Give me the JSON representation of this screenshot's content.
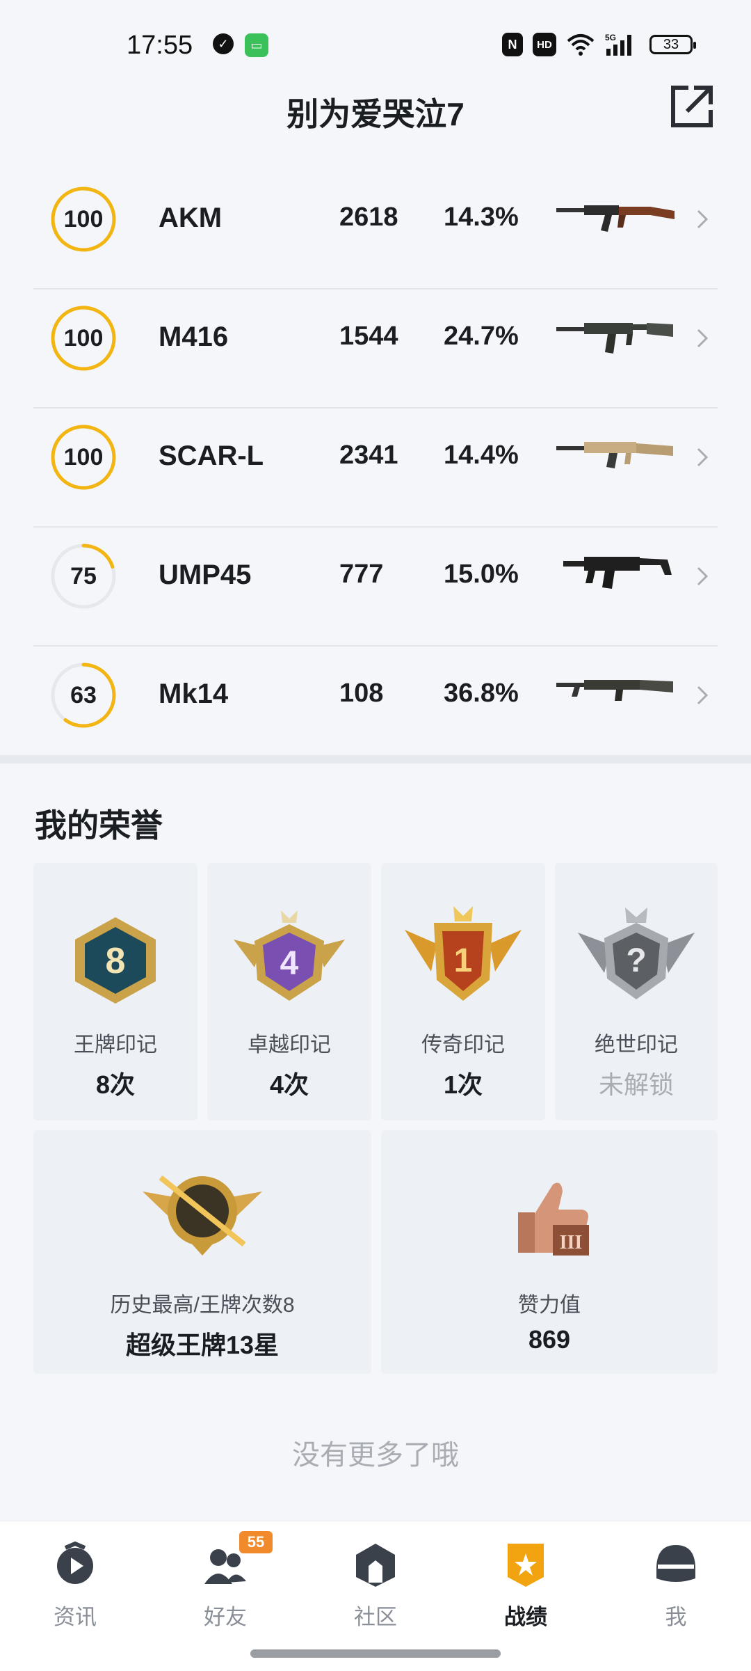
{
  "status_bar": {
    "time": "17:55",
    "battery": "33",
    "icons": [
      "shield-icon",
      "message-icon",
      "nfc-icon",
      "hd-icon",
      "wifi-icon",
      "signal-5g-icon",
      "battery-icon"
    ]
  },
  "header": {
    "title": "别为爱哭泣7",
    "share_icon": "share-external-icon"
  },
  "weapons": [
    {
      "level": "100",
      "progress": 1.0,
      "name": "AKM",
      "kills": "2618",
      "rate": "14.3%"
    },
    {
      "level": "100",
      "progress": 1.0,
      "name": "M416",
      "kills": "1544",
      "rate": "24.7%"
    },
    {
      "level": "100",
      "progress": 1.0,
      "name": "SCAR-L",
      "kills": "2341",
      "rate": "14.4%"
    },
    {
      "level": "75",
      "progress": 0.2,
      "name": "UMP45",
      "kills": "777",
      "rate": "15.0%"
    },
    {
      "level": "63",
      "progress": 0.6,
      "name": "Mk14",
      "kills": "108",
      "rate": "36.8%"
    }
  ],
  "honor": {
    "title": "我的荣誉",
    "marks": [
      {
        "label": "王牌印记",
        "value": "8次",
        "badge_number": "8"
      },
      {
        "label": "卓越印记",
        "value": "4次",
        "badge_number": "4"
      },
      {
        "label": "传奇印记",
        "value": "1次",
        "badge_number": "1"
      },
      {
        "label": "绝世印记",
        "value": "未解锁",
        "badge_number": "?"
      }
    ],
    "highest": {
      "label": "历史最高/王牌次数8",
      "value": "超级王牌13星"
    },
    "likes": {
      "label": "赞力值",
      "value": "869",
      "badge_number": "III"
    }
  },
  "footer_note": "没有更多了哦",
  "tabs": [
    {
      "label": "资讯",
      "icon": "news-play-icon"
    },
    {
      "label": "好友",
      "icon": "friends-icon",
      "badge": "55"
    },
    {
      "label": "社区",
      "icon": "community-icon"
    },
    {
      "label": "战绩",
      "icon": "record-shield-icon",
      "active": true
    },
    {
      "label": "我",
      "icon": "profile-helmet-icon"
    }
  ],
  "colors": {
    "ring": "#f2b511",
    "ring_track": "#e6e8ec",
    "active_tab": "#f2a410",
    "badge": "#f08a2b"
  }
}
